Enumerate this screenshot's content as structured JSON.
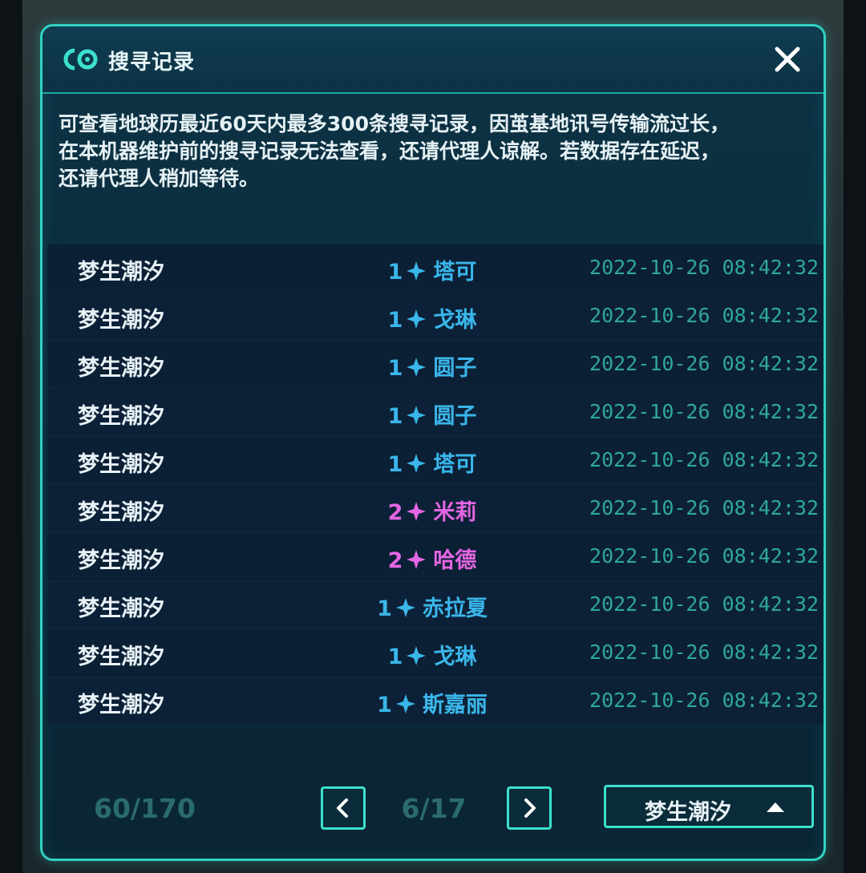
{
  "dialog": {
    "title": "搜寻记录",
    "close_symbol": "×",
    "notice": "可查看地球历最近60天内最多300条搜寻记录，因茧基地讯号传输流过长，\n在本机器维护前的搜寻记录无法查看，还请代理人谅解。若数据存在延迟，\n还请代理人稍加等待。"
  },
  "colors": {
    "accent": "#3ce0cf",
    "rarity_1": "#3ab6ea",
    "rarity_2": "#e466e2",
    "timestamp": "#2fa79c"
  },
  "records": [
    {
      "pool": "梦生潮汐",
      "rarity": "1",
      "name": "塔可",
      "time": "2022-10-26 08:42:32"
    },
    {
      "pool": "梦生潮汐",
      "rarity": "1",
      "name": "戈琳",
      "time": "2022-10-26 08:42:32"
    },
    {
      "pool": "梦生潮汐",
      "rarity": "1",
      "name": "圆子",
      "time": "2022-10-26 08:42:32"
    },
    {
      "pool": "梦生潮汐",
      "rarity": "1",
      "name": "圆子",
      "time": "2022-10-26 08:42:32"
    },
    {
      "pool": "梦生潮汐",
      "rarity": "1",
      "name": "塔可",
      "time": "2022-10-26 08:42:32"
    },
    {
      "pool": "梦生潮汐",
      "rarity": "2",
      "name": "米莉",
      "time": "2022-10-26 08:42:32"
    },
    {
      "pool": "梦生潮汐",
      "rarity": "2",
      "name": "哈德",
      "time": "2022-10-26 08:42:32"
    },
    {
      "pool": "梦生潮汐",
      "rarity": "1",
      "name": "赤拉夏",
      "time": "2022-10-26 08:42:32"
    },
    {
      "pool": "梦生潮汐",
      "rarity": "1",
      "name": "戈琳",
      "time": "2022-10-26 08:42:32"
    },
    {
      "pool": "梦生潮汐",
      "rarity": "1",
      "name": "斯嘉丽",
      "time": "2022-10-26 08:42:32"
    }
  ],
  "footer": {
    "count": "60/170",
    "page": "6/17",
    "pool_select": "梦生潮汐",
    "prev_icon": "chevron-left-icon",
    "next_icon": "chevron-right-icon",
    "dropdown_icon": "triangle-up-icon"
  }
}
